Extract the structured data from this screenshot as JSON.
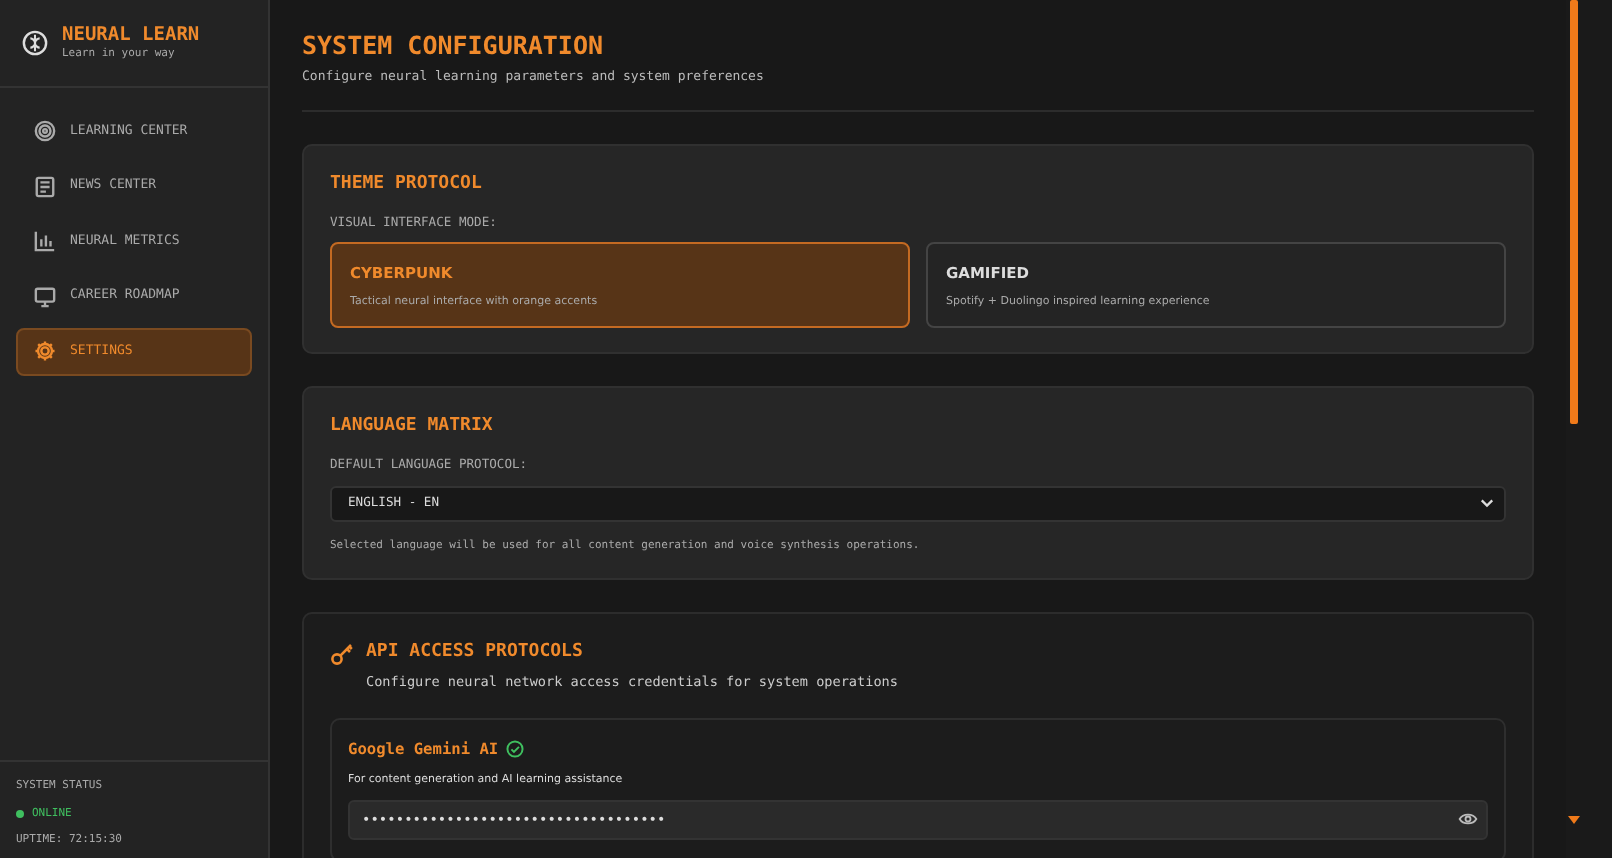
{
  "sidebar": {
    "brand": {
      "title": "NEURAL LEARN",
      "tagline": "Learn in your way"
    },
    "items": [
      {
        "label": "LEARNING CENTER",
        "selected": false
      },
      {
        "label": "NEWS CENTER",
        "selected": false
      },
      {
        "label": "NEURAL METRICS",
        "selected": false
      },
      {
        "label": "CAREER ROADMAP",
        "selected": false
      },
      {
        "label": "SETTINGS",
        "selected": true
      }
    ],
    "system_status": {
      "heading": "SYSTEM STATUS",
      "status": "ONLINE",
      "online": true,
      "uptime": "UPTIME: 72:15:30"
    }
  },
  "header": {
    "title": "SYSTEM CONFIGURATION",
    "subtitle": "Configure neural learning parameters and system preferences"
  },
  "theme_section": {
    "title": "THEME PROTOCOL",
    "label": "VISUAL INTERFACE MODE:",
    "options": [
      {
        "name": "CYBERPUNK",
        "description": "Tactical neural interface with orange accents",
        "selected": true
      },
      {
        "name": "GAMIFIED",
        "description": "Spotify + Duolingo inspired learning experience",
        "selected": false
      }
    ]
  },
  "language_section": {
    "title": "LANGUAGE MATRIX",
    "label": "DEFAULT LANGUAGE PROTOCOL:",
    "select": {
      "value": "ENGLISH - EN"
    },
    "note": "Selected language will be used for all content generation and voice synthesis operations."
  },
  "api_section": {
    "title": "API ACCESS PROTOCOLS",
    "subtitle": "Configure neural network access credentials for system operations",
    "providers": [
      {
        "name": "Google Gemini AI",
        "verified": true,
        "description": "For content generation and AI learning assistance",
        "key": {
          "value": "••••••••••••••••••••••••••••••••••••"
        }
      }
    ]
  }
}
